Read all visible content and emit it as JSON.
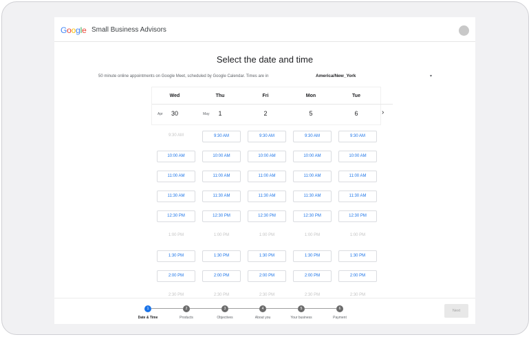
{
  "header": {
    "logo": [
      "G",
      "o",
      "o",
      "g",
      "l",
      "e"
    ],
    "logo_colors": [
      "#4285F4",
      "#EA4335",
      "#FBBC05",
      "#4285F4",
      "#34A853",
      "#EA4335"
    ],
    "app_name": "Small Business Advisors"
  },
  "main": {
    "title": "Select the date and time",
    "subtitle": "50 minute online appointments on Google Meet, scheduled by Google Calendar. Times are in",
    "timezone": "America/New_York",
    "tz_caret": "▾",
    "next_arrow": "›"
  },
  "calendar": {
    "days": [
      {
        "dow": "Wed",
        "month": "Apr",
        "day": "30"
      },
      {
        "dow": "Thu",
        "month": "May",
        "day": "1"
      },
      {
        "dow": "Fri",
        "month": "",
        "day": "2"
      },
      {
        "dow": "Mon",
        "month": "",
        "day": "5"
      },
      {
        "dow": "Tue",
        "month": "",
        "day": "6"
      }
    ],
    "times": [
      "9:30 AM",
      "10:00 AM",
      "11:00 AM",
      "11:30 AM",
      "12:30 PM",
      "1:00 PM",
      "1:30 PM",
      "2:00 PM",
      "2:30 PM"
    ],
    "availability": [
      [
        false,
        true,
        true,
        true,
        true
      ],
      [
        true,
        true,
        true,
        true,
        true
      ],
      [
        true,
        true,
        true,
        true,
        true
      ],
      [
        true,
        true,
        true,
        true,
        true
      ],
      [
        true,
        true,
        true,
        true,
        true
      ],
      [
        false,
        false,
        false,
        false,
        false
      ],
      [
        true,
        true,
        true,
        true,
        true
      ],
      [
        true,
        true,
        true,
        true,
        true
      ],
      [
        false,
        false,
        false,
        false,
        false
      ]
    ]
  },
  "stepper": {
    "steps": [
      {
        "num": "1",
        "label": "Date & Time",
        "active": true
      },
      {
        "num": "2",
        "label": "Products",
        "active": false
      },
      {
        "num": "3",
        "label": "Objectives",
        "active": false
      },
      {
        "num": "4",
        "label": "About you",
        "active": false
      },
      {
        "num": "5",
        "label": "Your business",
        "active": false
      },
      {
        "num": "6",
        "label": "Payment",
        "active": false
      }
    ],
    "next_label": "Next"
  }
}
